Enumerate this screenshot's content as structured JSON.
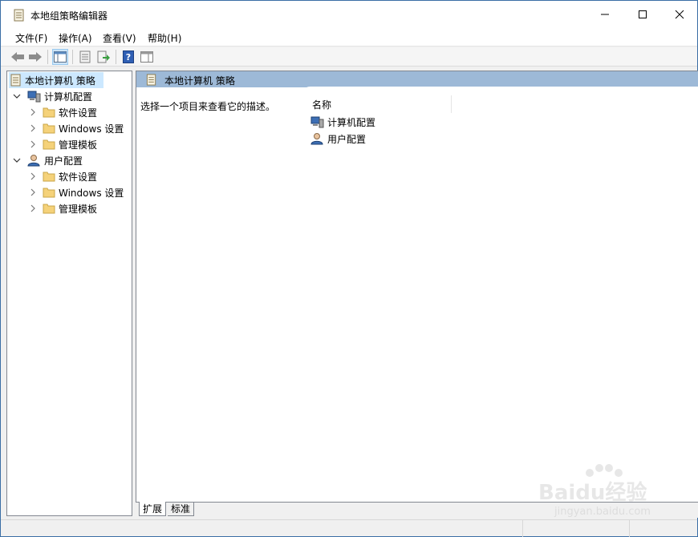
{
  "window": {
    "title": "本地组策略编辑器"
  },
  "menu": [
    "文件(F)",
    "操作(A)",
    "查看(V)",
    "帮助(H)"
  ],
  "tree": {
    "root": "本地计算机 策略",
    "computer": {
      "label": "计算机配置",
      "children": [
        "软件设置",
        "Windows 设置",
        "管理模板"
      ]
    },
    "user": {
      "label": "用户配置",
      "children": [
        "软件设置",
        "Windows 设置",
        "管理模板"
      ]
    }
  },
  "content": {
    "header_title": "本地计算机 策略",
    "description": "选择一个项目来查看它的描述。",
    "column_name": "名称",
    "items": [
      "计算机配置",
      "用户配置"
    ]
  },
  "tabs": [
    "扩展",
    "标准"
  ],
  "watermark": {
    "brand": "Baidu经验",
    "url": "jingyan.baidu.com"
  },
  "colors": {
    "header_band": "#9db9d7",
    "selection": "#cce8ff",
    "folder": "#f5d27a",
    "window_border": "#3a6ea5"
  }
}
